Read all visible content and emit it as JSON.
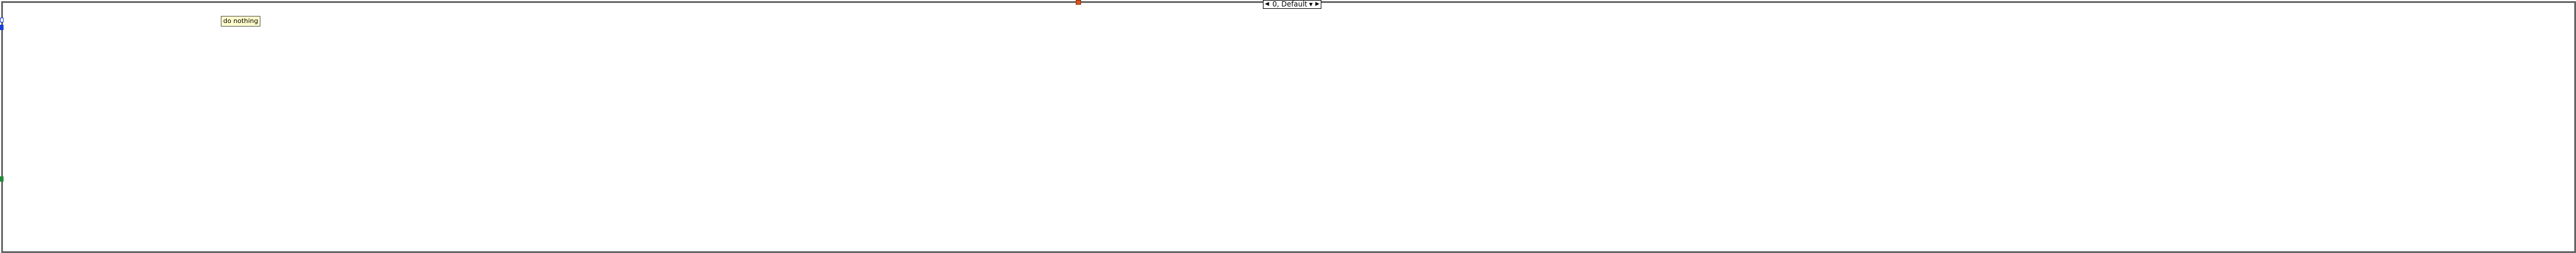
{
  "case_selector": {
    "label": "0, Default",
    "left_arrow_icon": "triangle-left-icon",
    "right_arrow_icon": "triangle-right-icon",
    "dropdown_icon": "chevron-down-icon"
  },
  "note": {
    "text": "do nothing"
  },
  "colors": {
    "frame_border": "#666666",
    "note_background": "#ffffcc",
    "selector_terminal": "#d9531e",
    "error_tunnel": "#1a3fd6",
    "data_tunnel": "#1f8a3a"
  }
}
